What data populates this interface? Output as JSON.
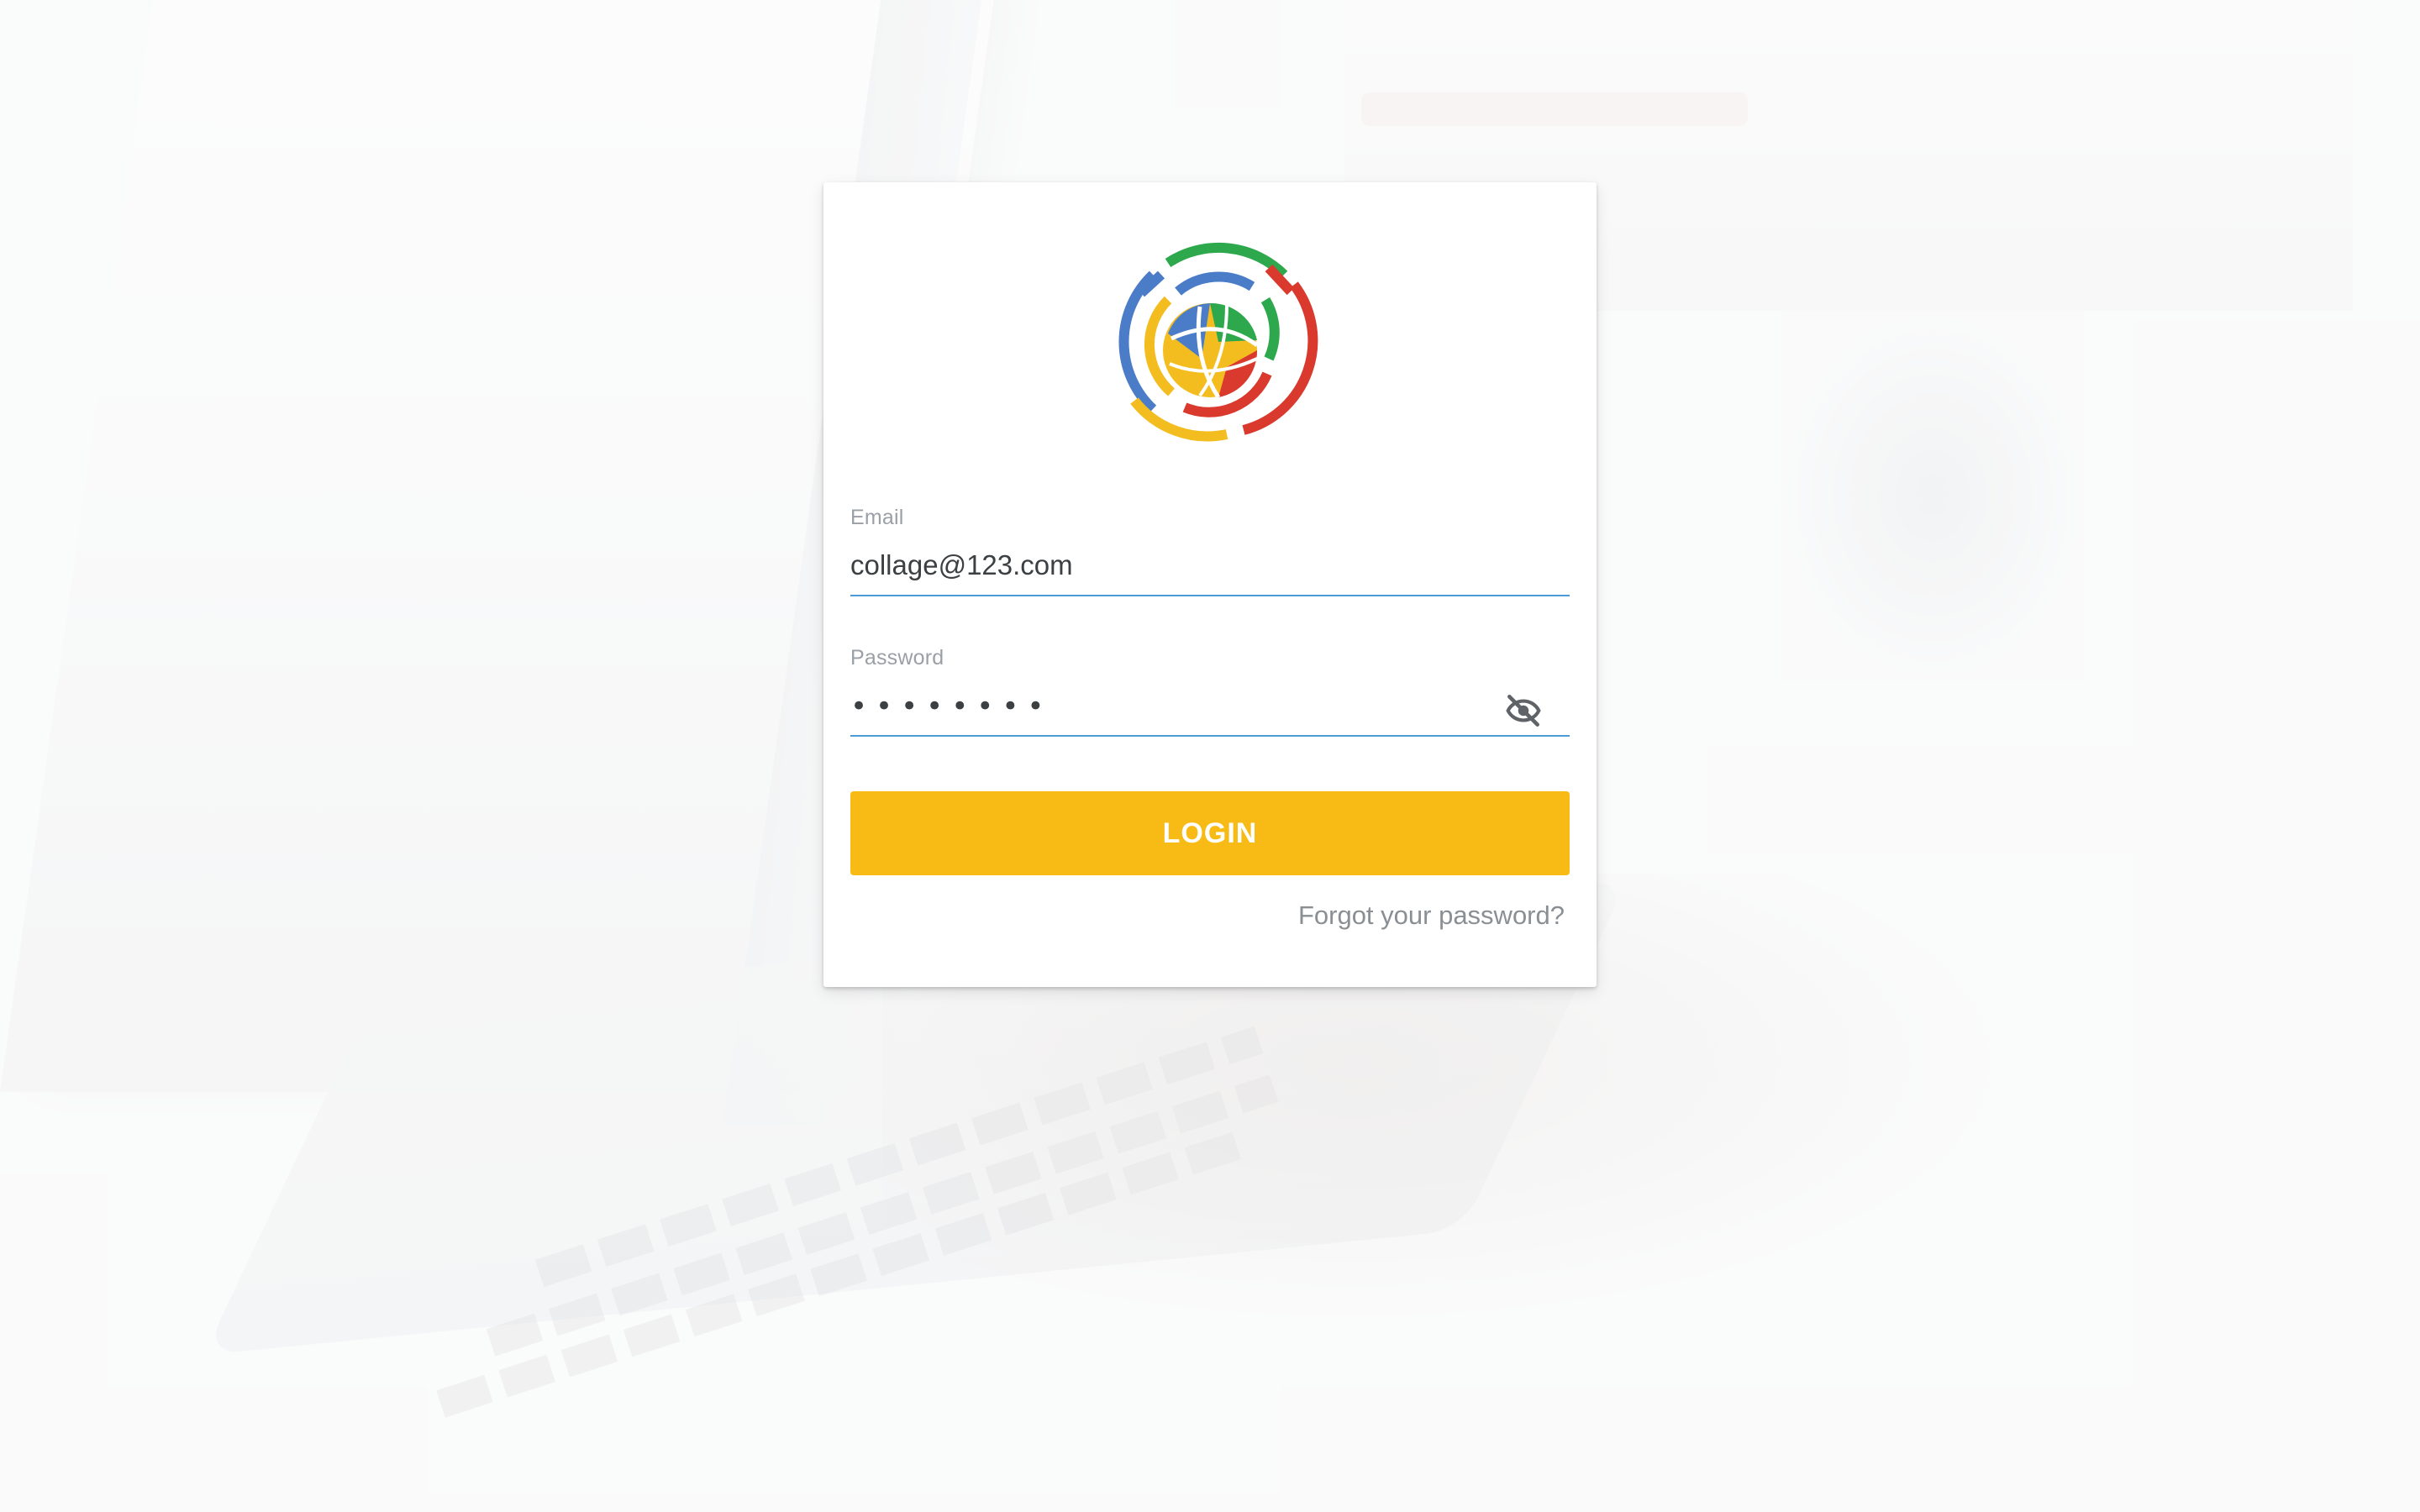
{
  "login_form": {
    "email": {
      "label": "Email",
      "value": "collage@123.com"
    },
    "password": {
      "label": "Password",
      "masked_value": "••••••••",
      "visibility_icon": "eye-off-icon"
    },
    "login_button_label": "LOGIN",
    "forgot_password_label": "Forgot your password?"
  },
  "logo": {
    "icon": "collage-globe-logo",
    "colors": {
      "blue": "#4a7cc7",
      "green": "#2ea84d",
      "red": "#d93a2d",
      "yellow": "#f4bd1f"
    }
  },
  "theme": {
    "accent": "#f8bb16",
    "underline": "#4a9bd6",
    "link": "#8a8f94"
  }
}
